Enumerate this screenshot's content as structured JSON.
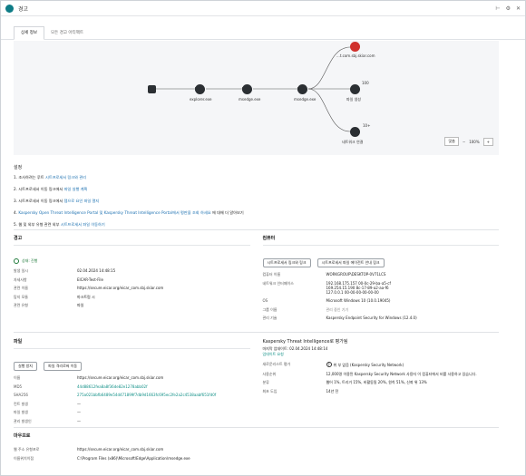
{
  "title_bar": {
    "title": "경고"
  },
  "tabs": [
    {
      "label": "상세 정보"
    },
    {
      "label": "모든 경고 아티팩트"
    }
  ],
  "graph": {
    "nodes": [
      {
        "label": ""
      },
      {
        "label": "explorer.exe"
      },
      {
        "label": "msedge.exe"
      },
      {
        "label": "msedge.exe"
      },
      {
        "label": "...t.com.sbj.skiar.com"
      },
      {
        "label": "파일 생성"
      },
      {
        "label": "네트워크 연결"
      }
    ],
    "badges": [
      "100",
      "10+"
    ],
    "zoom": {
      "reset_label": "맞춤",
      "level": "100%"
    }
  },
  "steps": {
    "title": "설정",
    "items": [
      {
        "prefix": "1. 조사하려는 루트",
        "link": "시트프로세서 링크와 관리",
        "suffix": ""
      },
      {
        "prefix": "2. 시트프로세서 이동 링크에서",
        "link": "파일 실행 계획",
        "suffix": ""
      },
      {
        "prefix": "3. 시트프로세서 이동 링크에서",
        "link": "탭으로 요인 파일 열지",
        "suffix": ""
      },
      {
        "prefix": "4.",
        "link": "Kaspersky Open Threat Intelligence Portal 및 Kaspersky Threat Intelligence Portal에서 평판을 조회 하세요",
        "suffix": " 에 대해 더 알아보기"
      },
      {
        "prefix": "5. 웹 및 외부 유형 관련 외부 ",
        "link": "시트프로세서 파일 이동하기",
        "suffix": ""
      }
    ]
  },
  "alert": {
    "header": "경고",
    "status": "상태: 진행",
    "rows": [
      {
        "k": "발생 일시",
        "v": "02.04.2024 14:48:15"
      },
      {
        "k": "자세사항",
        "v": "EICAR-Test-File"
      },
      {
        "k": "관련 이름",
        "v": "https://secure.eicar.org/eicar_com.sbj.skiar.com"
      },
      {
        "k": "탐지 모듈",
        "v": "마크트럼 시"
      },
      {
        "k": "관련 유형",
        "v": "파일"
      }
    ]
  },
  "device": {
    "header": "컴퓨터",
    "buttons": [
      "시트프로세서 링크와 링크",
      "시트프로세서 파일 에이전트 안내 링크"
    ],
    "rows": [
      {
        "k": "컴퓨터 이름",
        "v": "WORKGROUP\\DESKTOP-0V71LCS"
      },
      {
        "k": "네트워크 인터페이스",
        "v": "192.168.175.157  00-0c-29-ba-a5-cf\n169.254.15.190  8c-17-89-a2-aa-f6\n127.0.0.1  00-00-00-00-00-00"
      },
      {
        "k": "OS",
        "v": "Microsoft Windows 10 (10.0.19045)"
      },
      {
        "k": "그룹 이름",
        "v": "관리 중인 기기"
      },
      {
        "k": "관리 기술",
        "v": "Kaspersky Endpoint Security for Windows (12.4.0)"
      }
    ]
  },
  "file": {
    "header": "파일",
    "buttons": [
      "실행 방지",
      "파일 격리로써 이동"
    ],
    "rows": [
      {
        "k": "이름",
        "v": "https://secure.eicar.org/eicar_com.sbj.skiar.com",
        "lnk": false
      },
      {
        "k": "MD5",
        "v": "44d88612fea8a8f36de82e1278abb02f",
        "lnk": true
      },
      {
        "k": "SHA256",
        "v": "275a021bbfb6489e54d471899f7db9d1663fc695ec2fe2a2c4538aabf651fd0f",
        "lnk": true
      },
      {
        "k": "컨트 발생",
        "v": "—",
        "lnk": false
      },
      {
        "k": "파일 발생",
        "v": "—",
        "lnk": false
      },
      {
        "k": "관리 발생인",
        "v": "—",
        "lnk": false
      }
    ]
  },
  "reputation": {
    "header": "Kaspersky Threat Intelligence로 평가됨",
    "sub": "마지막 업데이트: 02.04.2024 14:48:14",
    "sub_link": "업데이트 요청",
    "rows": [
      {
        "k": "새로운리스트 평가",
        "v": "위 부 없음 (Kaspersky Security Network)"
      },
      {
        "k": "사용순위",
        "v": "12,000명 이용된 Kaspersky Security Network 사용자 이 컴퓨터에서 비를 사용하고 있습니다."
      },
      {
        "k": "분류",
        "v": "웹어 1%, 트리거 15%, 비활동됨 20%, 원칙 51%, 신뢰 위 13%"
      },
      {
        "k": "최초 도입",
        "v": "14년 전"
      }
    ]
  },
  "process": {
    "header": "마우프로",
    "rows": [
      {
        "k": "웹 주소 유형포로",
        "v": "https://secure.eicar.org/eicar_com.sbj.skiar.com"
      },
      {
        "k": "이름위치이점",
        "v": "C:\\Program Files (x86)\\Microsoft\\Edge\\Application\\msedge.exe"
      }
    ]
  }
}
